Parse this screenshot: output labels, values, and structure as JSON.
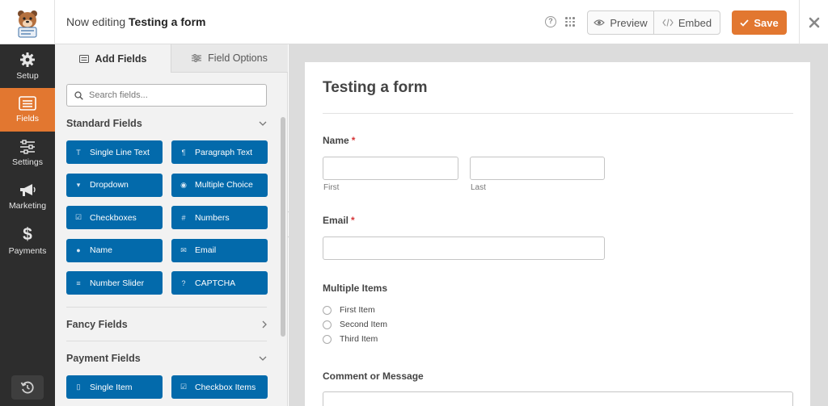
{
  "header": {
    "title_prefix": "Now editing",
    "form_name": "Testing a form",
    "preview_label": "Preview",
    "embed_label": "Embed",
    "save_label": "Save"
  },
  "nav": {
    "items": [
      {
        "label": "Setup",
        "icon": "gear-icon"
      },
      {
        "label": "Fields",
        "icon": "fields-list-icon"
      },
      {
        "label": "Settings",
        "icon": "sliders-icon"
      },
      {
        "label": "Marketing",
        "icon": "megaphone-icon"
      },
      {
        "label": "Payments",
        "icon": "dollar-icon"
      }
    ]
  },
  "panel": {
    "tabs": [
      {
        "label": "Add Fields"
      },
      {
        "label": "Field Options"
      }
    ],
    "search_placeholder": "Search fields...",
    "sections": {
      "standard": "Standard Fields",
      "fancy": "Fancy Fields",
      "payment": "Payment Fields"
    },
    "standard_fields": [
      {
        "label": "Single Line Text",
        "icon": "text-cursor-icon"
      },
      {
        "label": "Paragraph Text",
        "icon": "paragraph-icon"
      },
      {
        "label": "Dropdown",
        "icon": "dropdown-icon"
      },
      {
        "label": "Multiple Choice",
        "icon": "radio-icon"
      },
      {
        "label": "Checkboxes",
        "icon": "checkbox-icon"
      },
      {
        "label": "Numbers",
        "icon": "hash-icon"
      },
      {
        "label": "Name",
        "icon": "user-icon"
      },
      {
        "label": "Email",
        "icon": "envelope-icon"
      },
      {
        "label": "Number Slider",
        "icon": "slider-icon"
      },
      {
        "label": "CAPTCHA",
        "icon": "question-circle-icon"
      }
    ],
    "payment_fields": [
      {
        "label": "Single Item",
        "icon": "file-icon"
      },
      {
        "label": "Checkbox Items",
        "icon": "checkbox-icon"
      }
    ]
  },
  "form": {
    "title": "Testing a form",
    "name_label": "Name",
    "required_mark": "*",
    "first_sublabel": "First",
    "last_sublabel": "Last",
    "email_label": "Email",
    "multiple_label": "Multiple Items",
    "options": [
      "First Item",
      "Second Item",
      "Third Item"
    ],
    "comment_label": "Comment or Message"
  },
  "colors": {
    "accent": "#e27730",
    "field_button": "#036aab",
    "nav_bg": "#2d2d2d"
  }
}
